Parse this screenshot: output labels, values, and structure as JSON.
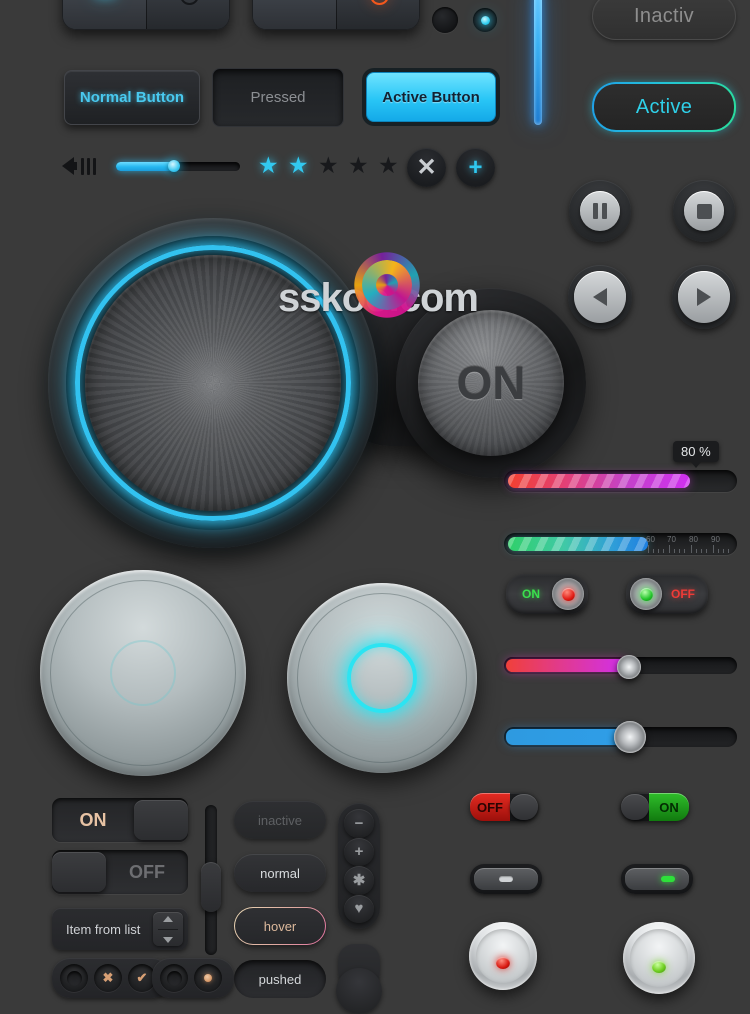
{
  "theme": {
    "background": "#3a3a3a",
    "accent_cyan": "#2fc7ef",
    "accent_green": "#2ade9c",
    "accent_red": "#e52b22",
    "accent_magenta": "#d02ff0",
    "text_light": "#d9dcdf",
    "text_dim": "#6d6e71"
  },
  "watermark": {
    "text": "sskoo.com"
  },
  "rockers": {
    "left": {
      "minus_label": "minus-dash",
      "power_label": "power-icon"
    },
    "right": {
      "minus_label": "minus-dash",
      "power_label": "power-icon"
    }
  },
  "leds": {
    "off_label": "led-off",
    "on_label": "led-on"
  },
  "state_buttons": [
    {
      "label": "Normal Button",
      "state": "normal"
    },
    {
      "label": "Pressed",
      "state": "pressed"
    },
    {
      "label": "Active Button",
      "state": "active"
    }
  ],
  "pill_buttons": [
    {
      "label": "Inactiv",
      "state": "inactive"
    },
    {
      "label": "Active",
      "state": "active"
    }
  ],
  "volume": {
    "value": 45,
    "icon": "speaker-icon"
  },
  "rating": {
    "value": 2,
    "max": 5
  },
  "icon_buttons": [
    {
      "name": "close-button",
      "glyph": "✕"
    },
    {
      "name": "add-button",
      "glyph": "+"
    }
  ],
  "big_knob": {
    "label": "",
    "glow": true
  },
  "on_pad": {
    "label": "ON"
  },
  "media_buttons": [
    {
      "name": "pause-button",
      "glyph": "pause"
    },
    {
      "name": "stop-button",
      "glyph": "stop"
    },
    {
      "name": "previous-button",
      "glyph": "previous"
    },
    {
      "name": "play-button",
      "glyph": "play"
    }
  ],
  "progress": {
    "magenta": {
      "value": 80,
      "tooltip": "80 %"
    },
    "green": {
      "value": 62,
      "ruler_ticks": [
        "60",
        "70",
        "80",
        "90"
      ]
    }
  },
  "small_rockers": [
    {
      "label": "ON",
      "state": "on",
      "lamp": "red",
      "lamp_side": "right"
    },
    {
      "label": "OFF",
      "state": "off",
      "lamp": "green",
      "lamp_side": "left"
    }
  ],
  "sliders": [
    {
      "name": "pink-slider",
      "value": 56
    },
    {
      "name": "blue-slider",
      "value": 53
    }
  ],
  "push_buttons": [
    {
      "name": "push-button-inactive",
      "lit": false
    },
    {
      "name": "push-button-active",
      "lit": true
    }
  ],
  "toggles": [
    {
      "label": "ON",
      "state": "on"
    },
    {
      "label": "OFF",
      "state": "off"
    }
  ],
  "list_item": {
    "label": "Item from list"
  },
  "check_group": [
    {
      "name": "checkbox-empty",
      "glyph": ""
    },
    {
      "name": "checkbox-cross",
      "glyph": "✖"
    },
    {
      "name": "checkbox-check",
      "glyph": "✔"
    }
  ],
  "radio_group": [
    {
      "name": "radio-empty",
      "glyph": ""
    },
    {
      "name": "radio-selected",
      "glyph": "●"
    }
  ],
  "vertical_slider": {
    "value": 50
  },
  "pill_states": [
    {
      "label": "inactive",
      "state": "inactive"
    },
    {
      "label": "normal",
      "state": "normal"
    },
    {
      "label": "hover",
      "state": "hover"
    },
    {
      "label": "pushed",
      "state": "pushed"
    }
  ],
  "icon_strip": [
    {
      "name": "minus-icon",
      "glyph": "−"
    },
    {
      "name": "plus-icon",
      "glyph": "+"
    },
    {
      "name": "star-icon",
      "glyph": "✱"
    },
    {
      "name": "heart-icon",
      "glyph": "♥"
    }
  ],
  "rect_toggles": [
    {
      "label": "OFF",
      "state": "off"
    },
    {
      "label": "ON",
      "state": "on"
    }
  ],
  "indicator_pills": [
    {
      "name": "indicator-gray",
      "lamp": "gray"
    },
    {
      "name": "indicator-green",
      "lamp": "green"
    }
  ],
  "metal_leds": [
    {
      "name": "metal-led-red",
      "lamp": "red"
    },
    {
      "name": "metal-led-green",
      "lamp": "green"
    }
  ]
}
